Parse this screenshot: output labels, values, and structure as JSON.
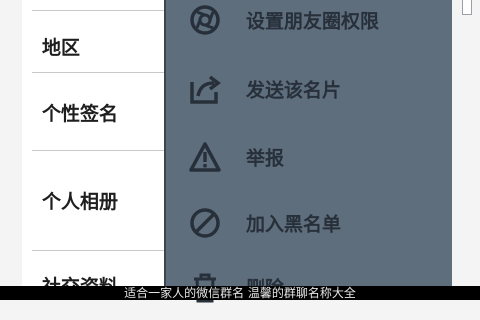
{
  "profile": {
    "rows": [
      {
        "label": "地区"
      },
      {
        "label": "个性签名"
      },
      {
        "label": "个人相册"
      },
      {
        "label": "社交资料"
      }
    ]
  },
  "menu": {
    "items": [
      {
        "label": "设置朋友圈权限",
        "icon": "moments-permission-icon"
      },
      {
        "label": "发送该名片",
        "icon": "share-card-icon"
      },
      {
        "label": "举报",
        "icon": "warning-icon"
      },
      {
        "label": "加入黑名单",
        "icon": "block-icon"
      },
      {
        "label": "删除",
        "icon": "trash-icon"
      }
    ]
  },
  "caption": {
    "text": "适合一家人的微信群名 温馨的群聊名称大全"
  },
  "colors": {
    "menu_bg": "#5f6e7d",
    "menu_text": "#27303a",
    "list_bg": "#ffffff"
  }
}
